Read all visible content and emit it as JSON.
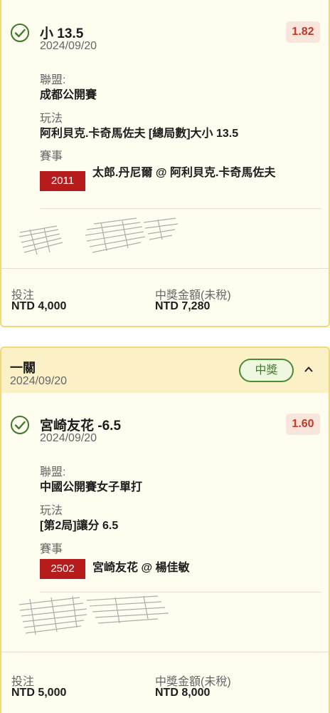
{
  "bets": [
    {
      "selection": {
        "title": "小 13.5",
        "date": "2024/09/20",
        "odds": "1.82",
        "league_label": "聯盟:",
        "league": "成都公開賽",
        "play_label": "玩法",
        "play": "阿利貝克.卡奇馬佐夫 [總局數]大小 13.5",
        "event_label": "賽事",
        "event_code": "2011",
        "event_name": "太郎.丹尼爾 @ 阿利貝克.卡奇馬佐夫"
      },
      "footer": {
        "stake_label": "投注",
        "stake": "NTD 4,000",
        "payout_label": "中獎金額(未稅)",
        "payout": "NTD 7,280"
      }
    },
    {
      "header": {
        "type": "一關",
        "date": "2024/09/20",
        "status": "中獎"
      },
      "selection": {
        "title": "宮崎友花 -6.5",
        "date": "2024/09/20",
        "odds": "1.60",
        "league_label": "聯盟:",
        "league": "中國公開賽女子單打",
        "play_label": "玩法",
        "play": "[第2局]讓分 6.5",
        "event_label": "賽事",
        "event_code": "2502",
        "event_name": "宮崎友花 @ 楊佳敏"
      },
      "footer": {
        "stake_label": "投注",
        "stake": "NTD 5,000",
        "payout_label": "中獎金額(未稅)",
        "payout": "NTD 8,000"
      }
    }
  ],
  "colors": {
    "card_bg": "#fffcf0",
    "card_border": "#f0d978",
    "header_bg": "#fbf0c6",
    "win_green": "#4e8a3b",
    "odds_red": "#c0392b",
    "event_code_bg": "#b71c1c"
  },
  "icons": {
    "check": "check-circle-icon",
    "collapse": "chevron-up-icon",
    "signature": "scribble-mark"
  }
}
